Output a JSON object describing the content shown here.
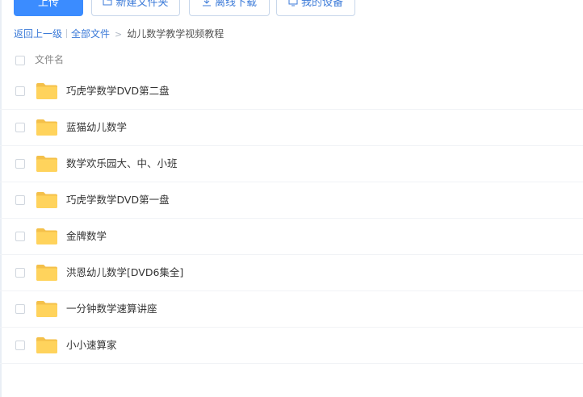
{
  "toolbar": {
    "upload_label": "上传",
    "new_folder_label": "新建文件夹",
    "offline_download_label": "离线下载",
    "my_devices_label": "我的设备"
  },
  "breadcrumb": {
    "back_label": "返回上一级",
    "all_files_label": "全部文件",
    "current_label": "幼儿数学教学视频教程"
  },
  "list": {
    "header_label": "文件名",
    "items": [
      {
        "name": "巧虎学数学DVD第二盘",
        "icon": "folder-icon"
      },
      {
        "name": "蓝猫幼儿数学",
        "icon": "folder-icon"
      },
      {
        "name": "数学欢乐园大、中、小班",
        "icon": "folder-icon"
      },
      {
        "name": "巧虎学数学DVD第一盘",
        "icon": "folder-icon"
      },
      {
        "name": "金牌数学",
        "icon": "folder-icon"
      },
      {
        "name": "洪恩幼儿数学[DVD6集全]",
        "icon": "folder-icon"
      },
      {
        "name": "一分钟数学速算讲座",
        "icon": "folder-icon"
      },
      {
        "name": "小小速算家",
        "icon": "folder-icon"
      }
    ]
  },
  "colors": {
    "primary": "#3b8cff",
    "link": "#3b7ad8",
    "folder": "#ffd35c"
  }
}
